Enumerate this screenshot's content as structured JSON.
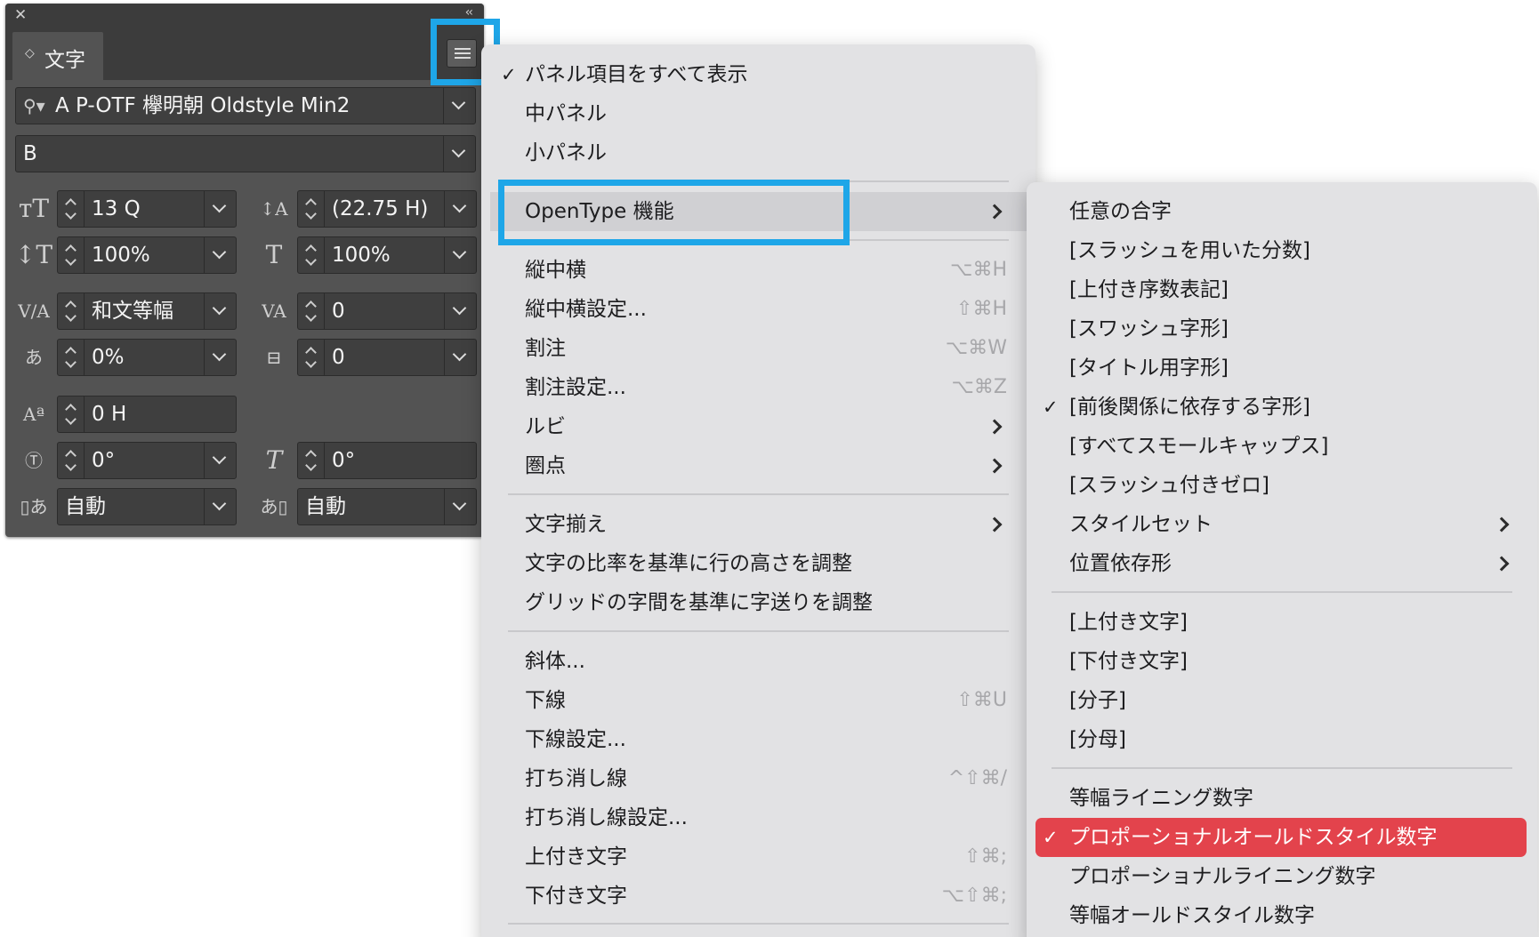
{
  "panel": {
    "tab_label": "文字",
    "font_family": "A P-OTF 欅明朝 Oldstyle Min2",
    "font_style": "B",
    "size": "13 Q",
    "leading": "(22.75 H)",
    "vertical_scale": "100%",
    "horizontal_scale": "100%",
    "kerning": "和文等幅",
    "tracking": "0",
    "tsume": "0%",
    "grid_spacing": "0",
    "baseline_shift": "0 H",
    "rotation": "0°",
    "skew": "0°",
    "aki_before": "自動",
    "aki_after": "自動"
  },
  "menu": {
    "items": [
      {
        "label": "パネル項目をすべて表示",
        "checked": true
      },
      {
        "label": "中パネル"
      },
      {
        "label": "小パネル"
      },
      {
        "label": "OpenType 機能",
        "submenu": true,
        "active": true
      },
      {
        "label": "縦中横",
        "shortcut": "⌥⌘H"
      },
      {
        "label": "縦中横設定...",
        "shortcut": "⇧⌘H"
      },
      {
        "label": "割注",
        "shortcut": "⌥⌘W"
      },
      {
        "label": "割注設定...",
        "shortcut": "⌥⌘Z"
      },
      {
        "label": "ルビ",
        "submenu": true
      },
      {
        "label": "圏点",
        "submenu": true
      },
      {
        "label": "文字揃え",
        "submenu": true
      },
      {
        "label": "文字の比率を基準に行の高さを調整"
      },
      {
        "label": "グリッドの字間を基準に字送りを調整"
      },
      {
        "label": "斜体..."
      },
      {
        "label": "下線",
        "shortcut": "⇧⌘U"
      },
      {
        "label": "下線設定..."
      },
      {
        "label": "打ち消し線",
        "shortcut": "^⇧⌘/"
      },
      {
        "label": "打ち消し線設定..."
      },
      {
        "label": "上付き文字",
        "shortcut": "⇧⌘;"
      },
      {
        "label": "下付き文字",
        "shortcut": "⌥⇧⌘;"
      }
    ]
  },
  "submenu": {
    "items": [
      {
        "label": "任意の合字"
      },
      {
        "label": "[スラッシュを用いた分数]"
      },
      {
        "label": "[上付き序数表記]"
      },
      {
        "label": "[スワッシュ字形]"
      },
      {
        "label": "[タイトル用字形]"
      },
      {
        "label": "[前後関係に依存する字形]",
        "checked": true
      },
      {
        "label": "[すべてスモールキャップス]"
      },
      {
        "label": "[スラッシュ付きゼロ]"
      },
      {
        "label": "スタイルセット",
        "submenu": true
      },
      {
        "label": "位置依存形",
        "submenu": true
      },
      {
        "label": "[上付き文字]"
      },
      {
        "label": "[下付き文字]"
      },
      {
        "label": "[分子]"
      },
      {
        "label": "[分母]"
      },
      {
        "label": "等幅ライニング数字"
      },
      {
        "label": "プロポーショナルオールドスタイル数字",
        "checked": true,
        "selected": true
      },
      {
        "label": "プロポーショナルライニング数字"
      },
      {
        "label": "等幅オールドスタイル数字"
      }
    ]
  },
  "colors": {
    "highlight_box": "#1ea6e8",
    "selected_item": "#e3434c",
    "panel_bg": "#535353",
    "menu_bg": "#e2e2e4"
  }
}
